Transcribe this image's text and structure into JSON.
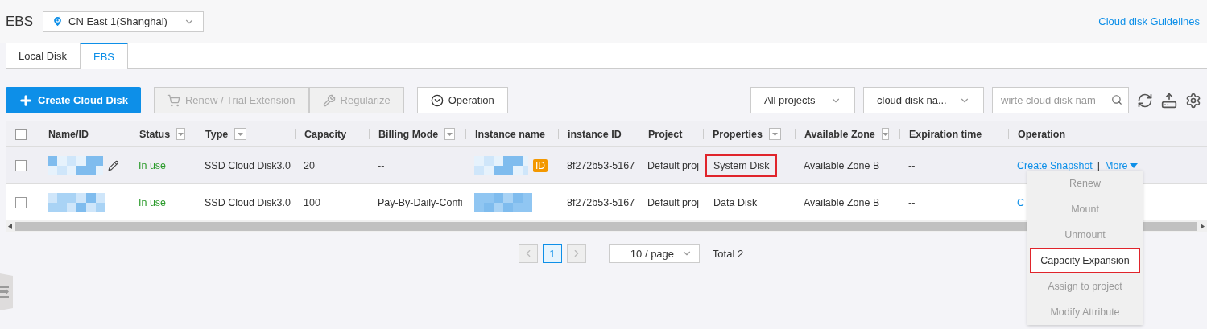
{
  "header": {
    "title": "EBS",
    "region": "CN East 1(Shanghai)",
    "guide_link": "Cloud disk Guidelines"
  },
  "tabs": [
    {
      "label": "Local Disk",
      "selected": false
    },
    {
      "label": "EBS",
      "selected": true
    }
  ],
  "toolbar": {
    "create": "Create Cloud Disk",
    "renew": {
      "label": "Renew / Trial Extension",
      "disabled": true
    },
    "regularize": {
      "label": "Regularize",
      "disabled": true
    },
    "operation": "Operation",
    "project_filter": "All projects",
    "field_filter": "cloud disk na...",
    "search": {
      "placeholder": "wirte cloud disk nam"
    }
  },
  "table": {
    "all_checked": false,
    "columns": [
      {
        "label": "Name/ID",
        "filter": false
      },
      {
        "label": "Status",
        "filter": true
      },
      {
        "label": "Type",
        "filter": true
      },
      {
        "label": "Capacity",
        "filter": false
      },
      {
        "label": "Billing Mode",
        "filter": true
      },
      {
        "label": "Instance name",
        "filter": false
      },
      {
        "label": "instance ID",
        "filter": false
      },
      {
        "label": "Project",
        "filter": false
      },
      {
        "label": "Properties",
        "filter": true
      },
      {
        "label": "Available Zone",
        "filter": true
      },
      {
        "label": "Expiration time",
        "filter": false
      },
      {
        "label": "Operation",
        "filter": false
      }
    ],
    "rows": [
      {
        "hovered": true,
        "checked": false,
        "status": "In use",
        "type": "SSD Cloud Disk3.0",
        "capacity": "20",
        "billing": "--",
        "instance_badge": "ID",
        "instance_id": "8f272b53-5167",
        "project": "Default proj",
        "properties": {
          "text": "System Disk",
          "highlighted": true
        },
        "zone": "Available Zone B",
        "expiration": "--",
        "actions": {
          "snapshot": "Create Snapshot",
          "separator": "|",
          "more": "More"
        }
      },
      {
        "hovered": false,
        "checked": false,
        "status": "In use",
        "type": "SSD Cloud Disk3.0",
        "capacity": "100",
        "billing": "Pay-By-Daily-Confi",
        "instance_id": "8f272b53-5167",
        "project": "Default proj",
        "properties": {
          "text": "Data Disk",
          "highlighted": false
        },
        "zone": "Available Zone B",
        "expiration": "--",
        "actions": {
          "snapshot": "C"
        }
      }
    ]
  },
  "pagination": {
    "pages": [
      {
        "label": "1",
        "selected": true
      }
    ],
    "page_size": "10 / page",
    "total": "Total 2"
  },
  "more_menu": [
    {
      "label": "Renew",
      "disabled": true,
      "highlighted": false
    },
    {
      "label": "Mount",
      "disabled": true,
      "highlighted": false
    },
    {
      "label": "Unmount",
      "disabled": true,
      "highlighted": false
    },
    {
      "label": "Capacity Expansion",
      "disabled": false,
      "highlighted": true
    },
    {
      "label": "Assign to project",
      "disabled": true,
      "highlighted": false
    },
    {
      "label": "Modify Attribute",
      "disabled": true,
      "highlighted": false
    }
  ]
}
